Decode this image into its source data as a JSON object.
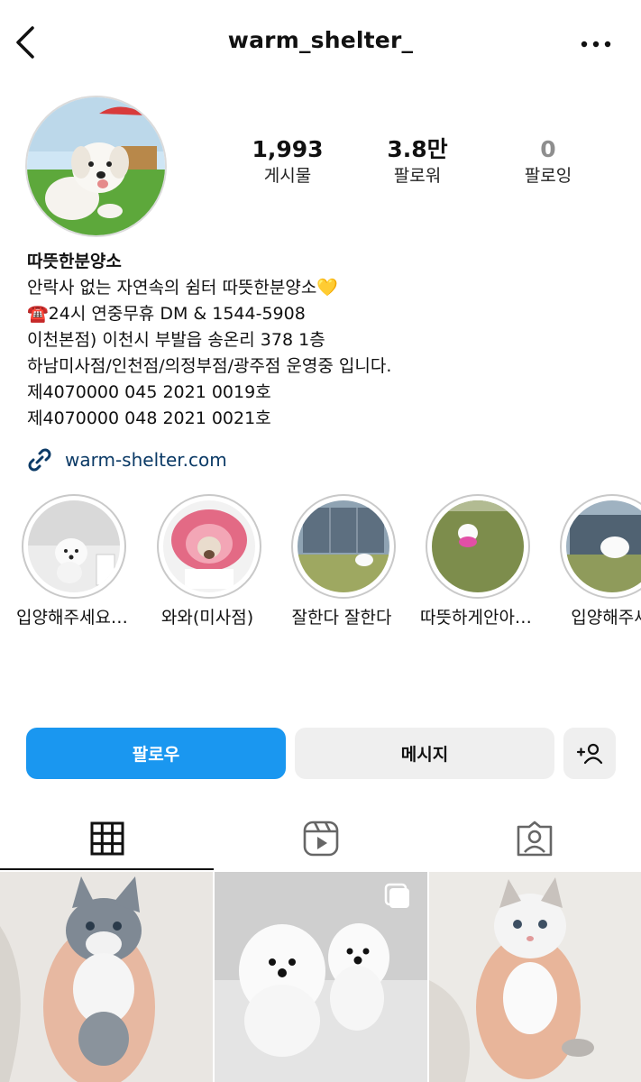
{
  "header": {
    "username": "warm_shelter_",
    "back_icon": "chevron-left-icon",
    "more_icon": "more-horizontal-icon"
  },
  "stats": {
    "posts": {
      "value": "1,993",
      "label": "게시물"
    },
    "followers": {
      "value": "3.8만",
      "label": "팔로워"
    },
    "following": {
      "value": "0",
      "label": "팔로잉"
    }
  },
  "bio": {
    "name": "따뜻한분양소",
    "lines": [
      "안락사 없는 자연속의 쉼터 따뜻한분양소💛",
      "☎️24시 연중무휴 DM & 1544-5908",
      "이천본점) 이천시 부발읍 송온리 378 1층",
      "하남미사점/인천점/의정부점/광주점 운영중 입니다.",
      "제4070000 045 2021 0019호",
      "제4070000 048 2021 0021호"
    ],
    "link": "warm-shelter.com"
  },
  "highlights": [
    {
      "caption": "입양해주세요…"
    },
    {
      "caption": "와와(미사점)"
    },
    {
      "caption": "잘한다 잘한다"
    },
    {
      "caption": "따뜻하게안아…"
    },
    {
      "caption": "입양해주세"
    }
  ],
  "actions": {
    "follow": "팔로우",
    "message": "메시지",
    "add_user_icon": "add-person-icon"
  },
  "tabs": [
    {
      "icon": "grid-icon",
      "active": true
    },
    {
      "icon": "reels-icon",
      "active": false
    },
    {
      "icon": "tagged-icon",
      "active": false
    }
  ],
  "colors": {
    "accent": "#1a97f0",
    "secondary_button": "#efefef",
    "link": "#0b3a66"
  }
}
